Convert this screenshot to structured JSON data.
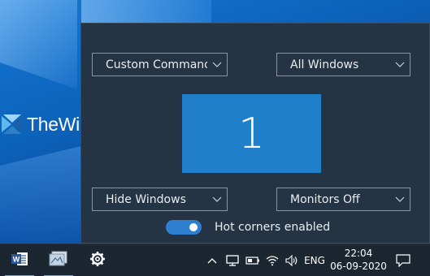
{
  "watermark": {
    "text": "TheWindowsClub"
  },
  "hot_corners": {
    "top_left": "Custom Command",
    "top_right": "All Windows",
    "bottom_left": "Hide Windows",
    "bottom_right": "Monitors Off",
    "monitor_number": "1",
    "toggle_label": "Hot corners enabled",
    "toggle_on": true,
    "accent_color": "#1f7fc9"
  },
  "taskbar": {
    "apps": [
      "word-icon",
      "photos-icon",
      "settings-icon"
    ],
    "language": "ENG",
    "time": "22:04",
    "date": "06-09-2020"
  }
}
